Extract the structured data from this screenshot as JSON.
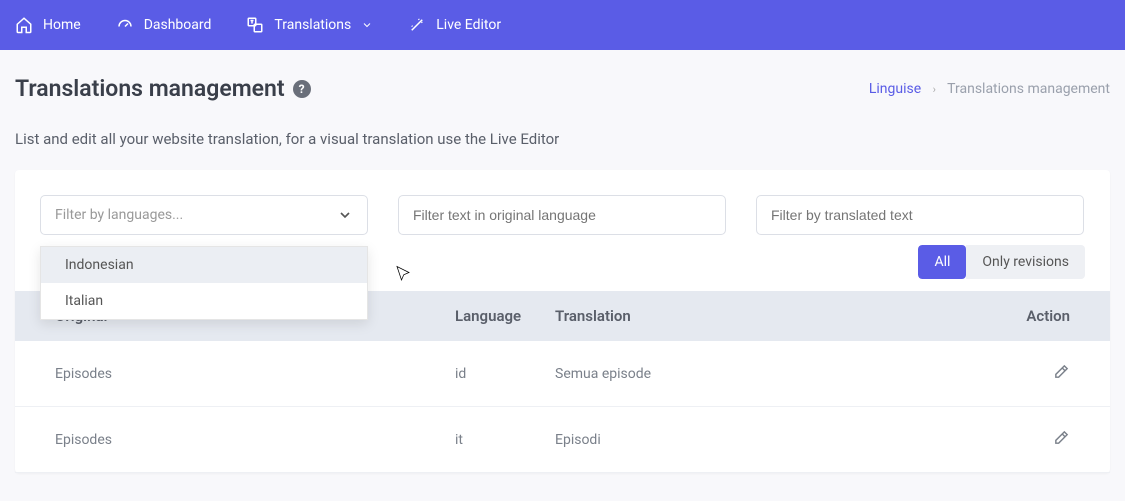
{
  "nav": {
    "items": [
      {
        "label": "Home"
      },
      {
        "label": "Dashboard"
      },
      {
        "label": "Translations"
      },
      {
        "label": "Live Editor"
      }
    ]
  },
  "header": {
    "title": "Translations management",
    "subtitle": "List and edit all your website translation, for a visual translation use the Live Editor"
  },
  "breadcrumb": {
    "link": "Linguise",
    "sep": "›",
    "current": "Translations management"
  },
  "filters": {
    "lang_placeholder": "Filter by languages...",
    "orig_placeholder": "Filter text in original language",
    "trans_placeholder": "Filter by translated text",
    "dropdown": {
      "items": [
        "Indonesian",
        "Italian"
      ]
    }
  },
  "toggle": {
    "all": "All",
    "revisions": "Only revisions"
  },
  "table": {
    "cols": {
      "original": "Original",
      "language": "Language",
      "translation": "Translation",
      "action": "Action"
    },
    "rows": [
      {
        "original": "Episodes",
        "lang": "id",
        "trans": "Semua episode"
      },
      {
        "original": "Episodes",
        "lang": "it",
        "trans": "Episodi"
      }
    ]
  }
}
